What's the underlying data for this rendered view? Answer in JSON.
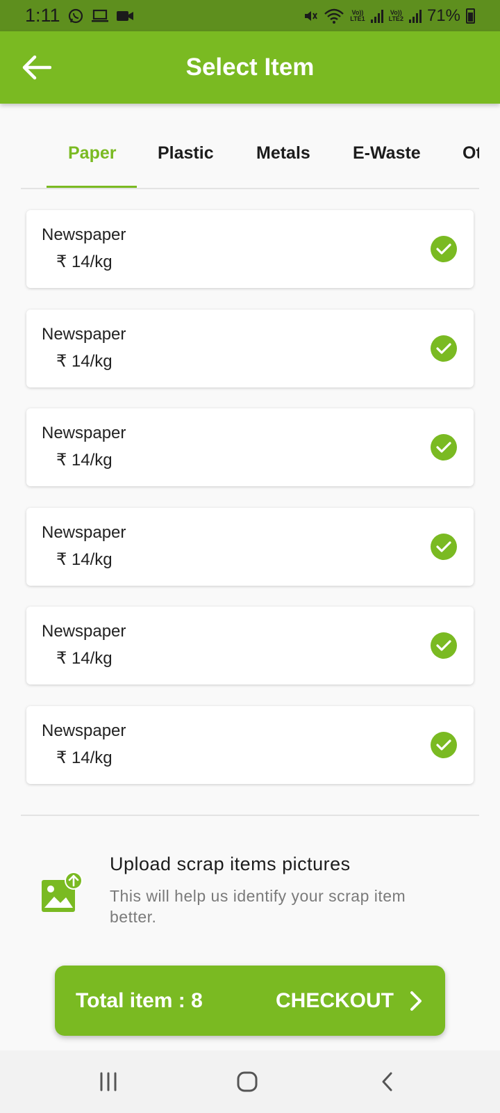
{
  "status_bar": {
    "time": "1:11",
    "battery": "71%",
    "net1_top": "Vo))",
    "net1_bottom": "LTE1",
    "net2_top": "Vo))",
    "net2_bottom": "LTE2"
  },
  "app_bar": {
    "title": "Select Item"
  },
  "tabs": [
    {
      "label": "Paper"
    },
    {
      "label": "Plastic"
    },
    {
      "label": "Metals"
    },
    {
      "label": "E-Waste"
    },
    {
      "label": "Ot"
    }
  ],
  "items": [
    {
      "name": "Newspaper",
      "price": "₹ 14/kg"
    },
    {
      "name": "Newspaper",
      "price": "₹ 14/kg"
    },
    {
      "name": "Newspaper",
      "price": "₹ 14/kg"
    },
    {
      "name": "Newspaper",
      "price": "₹ 14/kg"
    },
    {
      "name": "Newspaper",
      "price": "₹ 14/kg"
    },
    {
      "name": "Newspaper",
      "price": "₹ 14/kg"
    }
  ],
  "upload": {
    "title": "Upload scrap items pictures",
    "subtitle": "This will help us identify your scrap item better."
  },
  "checkout": {
    "total": "Total item : 8",
    "label": "CHECKOUT"
  },
  "colors": {
    "primary": "#7aba22",
    "status_bar": "#5e8f1e"
  }
}
